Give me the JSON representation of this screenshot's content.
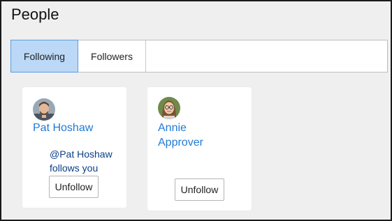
{
  "page": {
    "title": "People"
  },
  "tabs": [
    {
      "label": "Following",
      "active": true
    },
    {
      "label": "Followers",
      "active": false
    }
  ],
  "people": [
    {
      "name": "Pat Hoshaw",
      "note": "@Pat Hoshaw follows you",
      "button_label": "Unfollow",
      "avatar": "man-portrait-avatar"
    },
    {
      "name": "Annie Approver",
      "note": "",
      "button_label": "Unfollow",
      "avatar": "woman-glasses-portrait-avatar"
    }
  ],
  "colors": {
    "accent_link": "#1f7ad6",
    "active_tab_bg": "#bcd8f7",
    "active_tab_border": "#5a9be0",
    "note_text": "#0b3f86"
  }
}
